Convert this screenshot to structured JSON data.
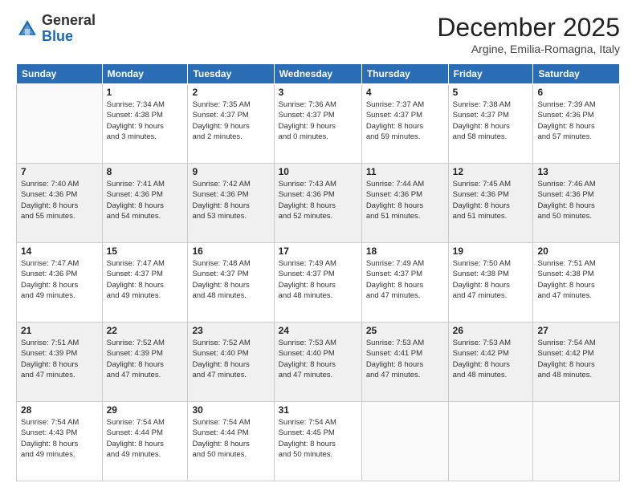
{
  "logo": {
    "general": "General",
    "blue": "Blue"
  },
  "title": "December 2025",
  "subtitle": "Argine, Emilia-Romagna, Italy",
  "days_header": [
    "Sunday",
    "Monday",
    "Tuesday",
    "Wednesday",
    "Thursday",
    "Friday",
    "Saturday"
  ],
  "weeks": [
    [
      {
        "day": "",
        "text": ""
      },
      {
        "day": "1",
        "text": "Sunrise: 7:34 AM\nSunset: 4:38 PM\nDaylight: 9 hours\nand 3 minutes."
      },
      {
        "day": "2",
        "text": "Sunrise: 7:35 AM\nSunset: 4:37 PM\nDaylight: 9 hours\nand 2 minutes."
      },
      {
        "day": "3",
        "text": "Sunrise: 7:36 AM\nSunset: 4:37 PM\nDaylight: 9 hours\nand 0 minutes."
      },
      {
        "day": "4",
        "text": "Sunrise: 7:37 AM\nSunset: 4:37 PM\nDaylight: 8 hours\nand 59 minutes."
      },
      {
        "day": "5",
        "text": "Sunrise: 7:38 AM\nSunset: 4:37 PM\nDaylight: 8 hours\nand 58 minutes."
      },
      {
        "day": "6",
        "text": "Sunrise: 7:39 AM\nSunset: 4:36 PM\nDaylight: 8 hours\nand 57 minutes."
      }
    ],
    [
      {
        "day": "7",
        "text": "Sunrise: 7:40 AM\nSunset: 4:36 PM\nDaylight: 8 hours\nand 55 minutes."
      },
      {
        "day": "8",
        "text": "Sunrise: 7:41 AM\nSunset: 4:36 PM\nDaylight: 8 hours\nand 54 minutes."
      },
      {
        "day": "9",
        "text": "Sunrise: 7:42 AM\nSunset: 4:36 PM\nDaylight: 8 hours\nand 53 minutes."
      },
      {
        "day": "10",
        "text": "Sunrise: 7:43 AM\nSunset: 4:36 PM\nDaylight: 8 hours\nand 52 minutes."
      },
      {
        "day": "11",
        "text": "Sunrise: 7:44 AM\nSunset: 4:36 PM\nDaylight: 8 hours\nand 51 minutes."
      },
      {
        "day": "12",
        "text": "Sunrise: 7:45 AM\nSunset: 4:36 PM\nDaylight: 8 hours\nand 51 minutes."
      },
      {
        "day": "13",
        "text": "Sunrise: 7:46 AM\nSunset: 4:36 PM\nDaylight: 8 hours\nand 50 minutes."
      }
    ],
    [
      {
        "day": "14",
        "text": "Sunrise: 7:47 AM\nSunset: 4:36 PM\nDaylight: 8 hours\nand 49 minutes."
      },
      {
        "day": "15",
        "text": "Sunrise: 7:47 AM\nSunset: 4:37 PM\nDaylight: 8 hours\nand 49 minutes."
      },
      {
        "day": "16",
        "text": "Sunrise: 7:48 AM\nSunset: 4:37 PM\nDaylight: 8 hours\nand 48 minutes."
      },
      {
        "day": "17",
        "text": "Sunrise: 7:49 AM\nSunset: 4:37 PM\nDaylight: 8 hours\nand 48 minutes."
      },
      {
        "day": "18",
        "text": "Sunrise: 7:49 AM\nSunset: 4:37 PM\nDaylight: 8 hours\nand 47 minutes."
      },
      {
        "day": "19",
        "text": "Sunrise: 7:50 AM\nSunset: 4:38 PM\nDaylight: 8 hours\nand 47 minutes."
      },
      {
        "day": "20",
        "text": "Sunrise: 7:51 AM\nSunset: 4:38 PM\nDaylight: 8 hours\nand 47 minutes."
      }
    ],
    [
      {
        "day": "21",
        "text": "Sunrise: 7:51 AM\nSunset: 4:39 PM\nDaylight: 8 hours\nand 47 minutes."
      },
      {
        "day": "22",
        "text": "Sunrise: 7:52 AM\nSunset: 4:39 PM\nDaylight: 8 hours\nand 47 minutes."
      },
      {
        "day": "23",
        "text": "Sunrise: 7:52 AM\nSunset: 4:40 PM\nDaylight: 8 hours\nand 47 minutes."
      },
      {
        "day": "24",
        "text": "Sunrise: 7:53 AM\nSunset: 4:40 PM\nDaylight: 8 hours\nand 47 minutes."
      },
      {
        "day": "25",
        "text": "Sunrise: 7:53 AM\nSunset: 4:41 PM\nDaylight: 8 hours\nand 47 minutes."
      },
      {
        "day": "26",
        "text": "Sunrise: 7:53 AM\nSunset: 4:42 PM\nDaylight: 8 hours\nand 48 minutes."
      },
      {
        "day": "27",
        "text": "Sunrise: 7:54 AM\nSunset: 4:42 PM\nDaylight: 8 hours\nand 48 minutes."
      }
    ],
    [
      {
        "day": "28",
        "text": "Sunrise: 7:54 AM\nSunset: 4:43 PM\nDaylight: 8 hours\nand 49 minutes."
      },
      {
        "day": "29",
        "text": "Sunrise: 7:54 AM\nSunset: 4:44 PM\nDaylight: 8 hours\nand 49 minutes."
      },
      {
        "day": "30",
        "text": "Sunrise: 7:54 AM\nSunset: 4:44 PM\nDaylight: 8 hours\nand 50 minutes."
      },
      {
        "day": "31",
        "text": "Sunrise: 7:54 AM\nSunset: 4:45 PM\nDaylight: 8 hours\nand 50 minutes."
      },
      {
        "day": "",
        "text": ""
      },
      {
        "day": "",
        "text": ""
      },
      {
        "day": "",
        "text": ""
      }
    ]
  ]
}
